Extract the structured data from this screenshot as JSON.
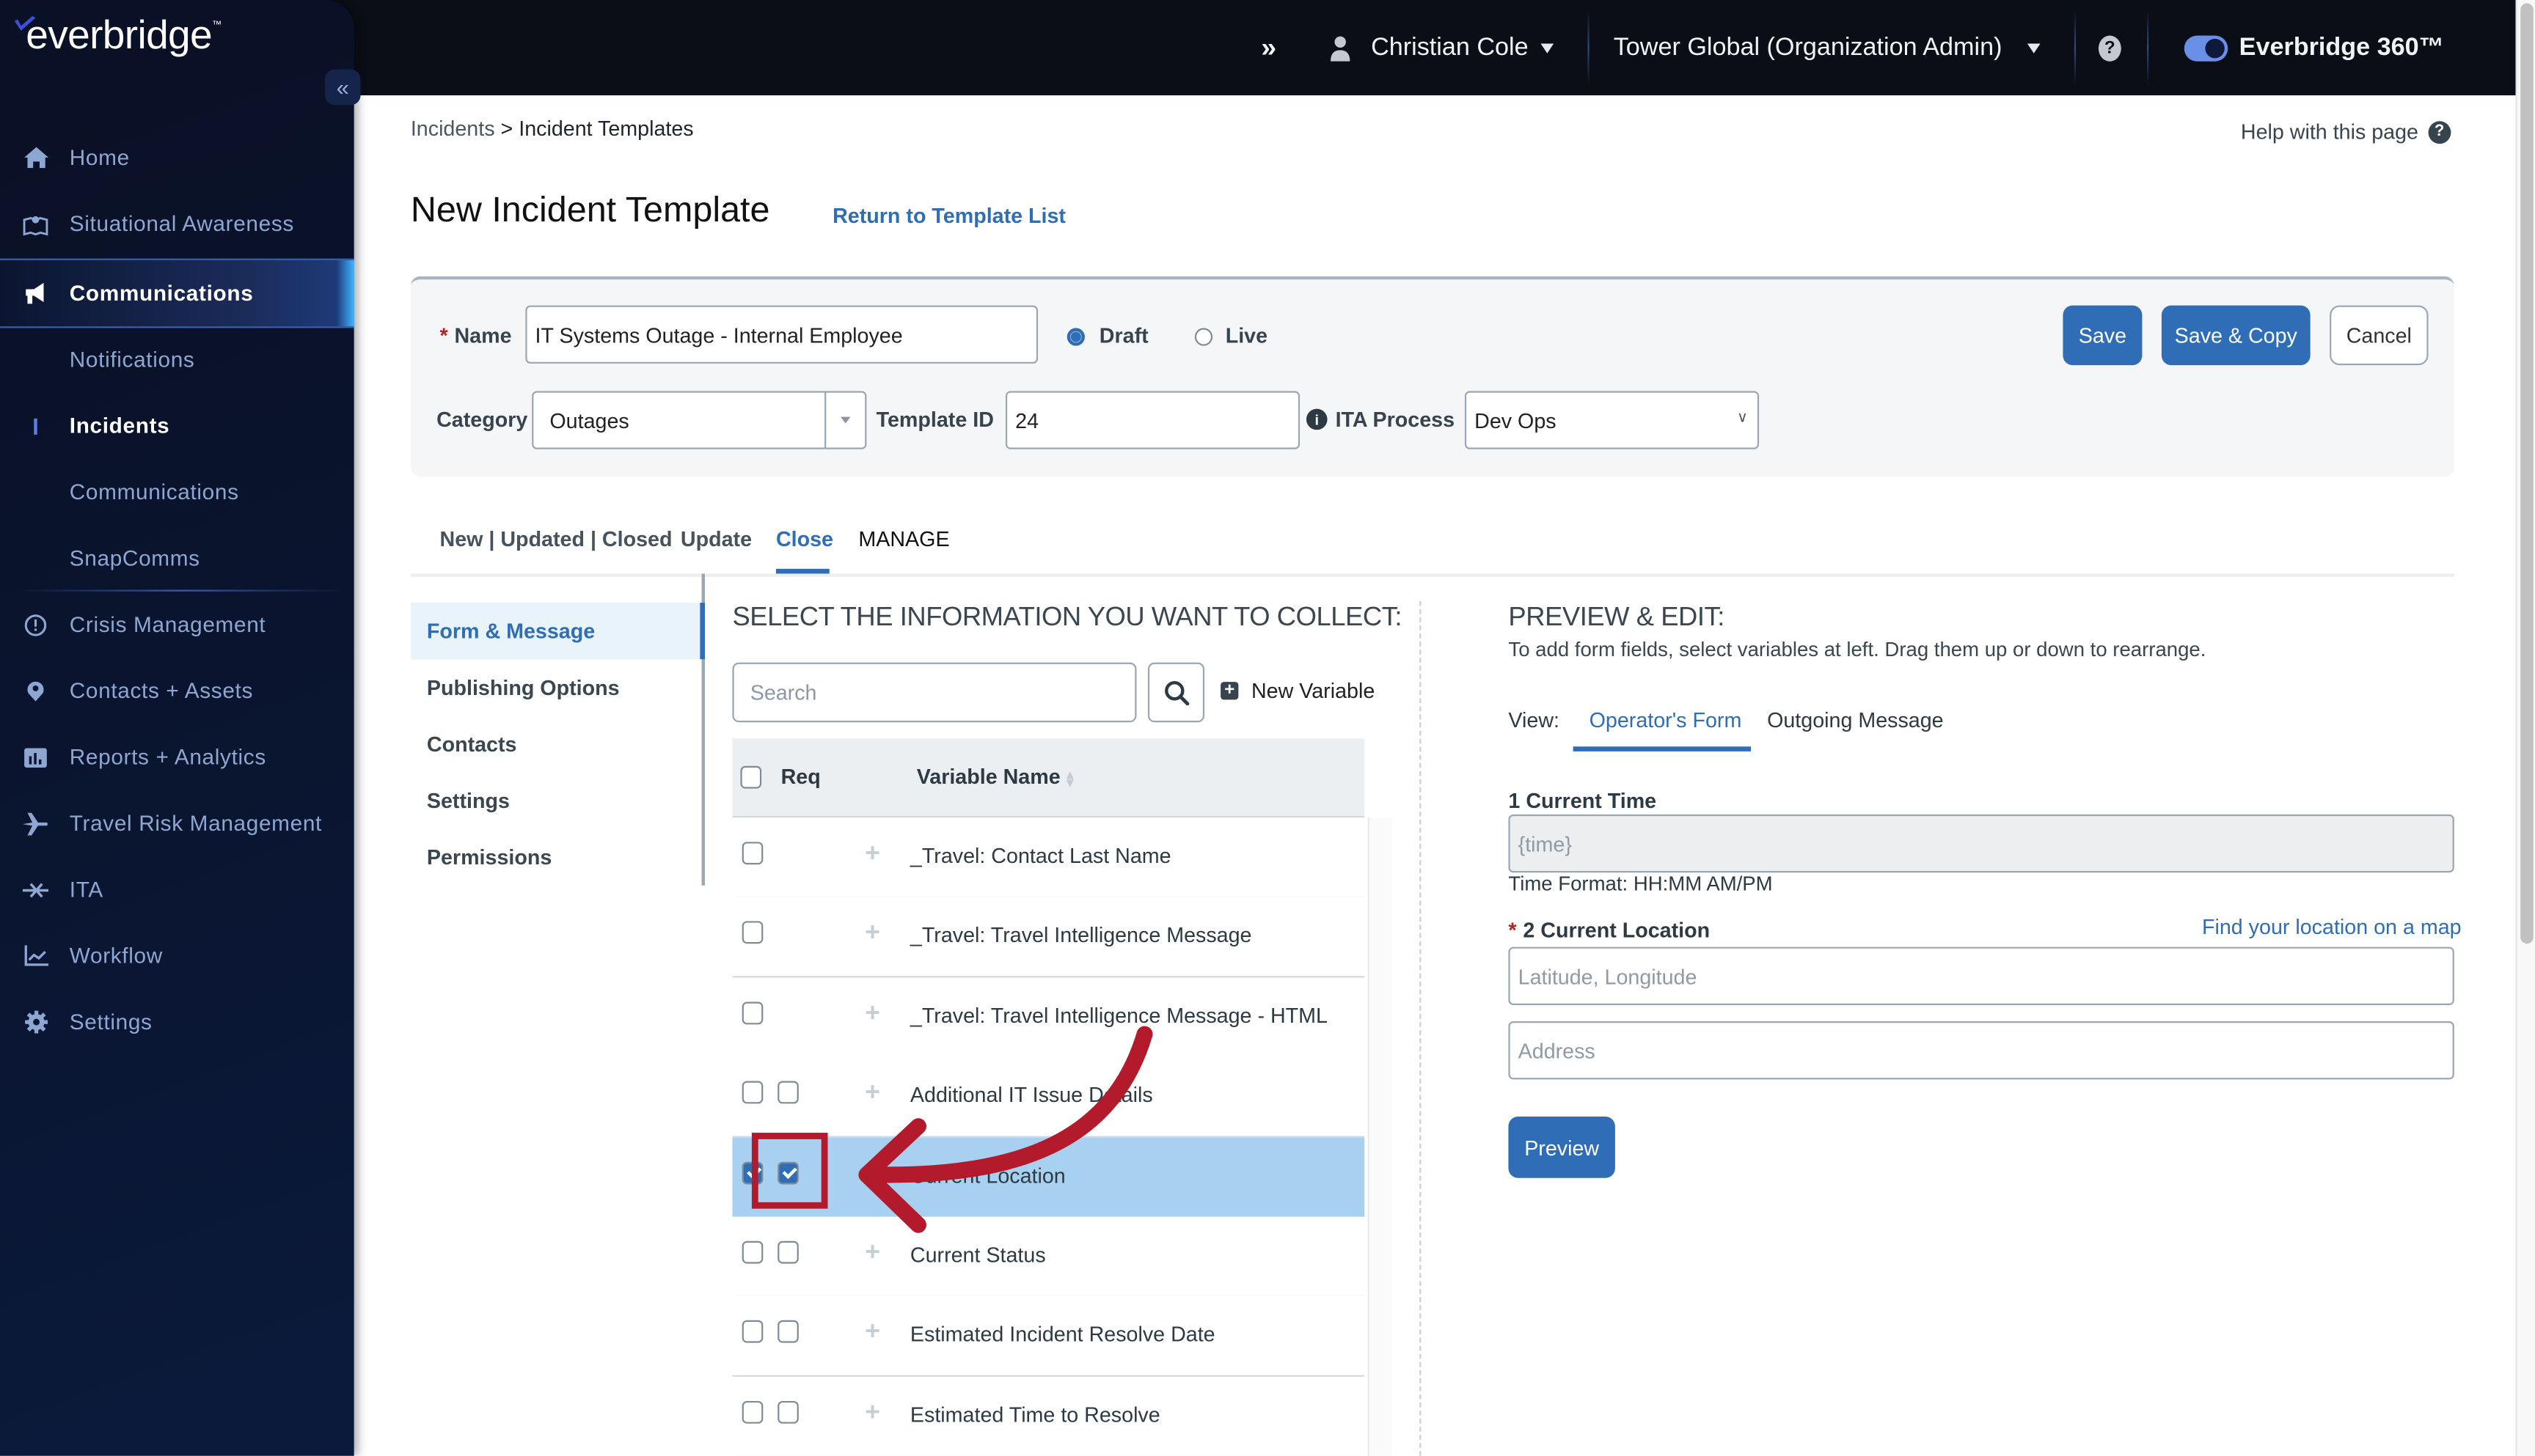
{
  "topbar": {
    "expand_icon": "double-chevron-right",
    "user_name": "Christian Cole",
    "organization": "Tower Global (Organization Admin)",
    "help_icon": "question-circle",
    "product_toggle_on": true,
    "product_name": "Everbridge 360™"
  },
  "sidebar": {
    "logo_text": "everbridge",
    "logo_tm": "™",
    "collapse_icon": "«",
    "items": [
      {
        "label": "Home",
        "icon": "home-icon"
      },
      {
        "label": "Situational Awareness",
        "icon": "map-pin-icon"
      },
      {
        "label": "Communications",
        "icon": "megaphone-icon",
        "active": true
      },
      {
        "label": "Crisis Management",
        "icon": "alert-circle-icon"
      },
      {
        "label": "Contacts + Assets",
        "icon": "contact-pin-icon"
      },
      {
        "label": "Reports + Analytics",
        "icon": "bar-chart-icon"
      },
      {
        "label": "Travel Risk Management",
        "icon": "airplane-icon"
      },
      {
        "label": "ITA",
        "icon": "ita-icon"
      },
      {
        "label": "Workflow",
        "icon": "line-chart-icon"
      },
      {
        "label": "Settings",
        "icon": "gear-icon"
      }
    ],
    "subitems": [
      {
        "label": "Notifications"
      },
      {
        "label": "Incidents",
        "active": true
      },
      {
        "label": "Communications"
      },
      {
        "label": "SnapComms"
      }
    ]
  },
  "breadcrumb": {
    "parent": "Incidents",
    "separator": " > ",
    "current": "Incident Templates"
  },
  "help_link": "Help with this page",
  "page_title": "New Incident Template",
  "return_link": "Return to Template List",
  "form": {
    "name_label": "Name",
    "name_value": "IT Systems Outage - Internal Employee",
    "status_options": [
      {
        "label": "Draft",
        "selected": true
      },
      {
        "label": "Live",
        "selected": false
      }
    ],
    "category_label": "Category",
    "category_value": "Outages",
    "template_id_label": "Template ID",
    "template_id_value": "24",
    "ita_process_label": "ITA Process",
    "ita_process_value": "Dev Ops",
    "buttons": {
      "save": "Save",
      "save_copy": "Save & Copy",
      "cancel": "Cancel"
    }
  },
  "tabs": [
    {
      "label": "New | Updated | Closed"
    },
    {
      "label": "Update"
    },
    {
      "label": "Close",
      "active": true
    },
    {
      "label": "MANAGE"
    }
  ],
  "left_nav": [
    {
      "label": "Form & Message",
      "active": true
    },
    {
      "label": "Publishing Options"
    },
    {
      "label": "Contacts"
    },
    {
      "label": "Settings"
    },
    {
      "label": "Permissions"
    }
  ],
  "collect": {
    "title": "SELECT THE INFORMATION YOU WANT TO COLLECT:",
    "search_placeholder": "Search",
    "new_variable": "New Variable",
    "columns": {
      "req": "Req",
      "variable_name": "Variable Name"
    },
    "rows": [
      {
        "name": "_Travel: Contact Last Name",
        "checked": false,
        "req": null,
        "selected": false
      },
      {
        "name": "_Travel: Travel Intelligence Message",
        "checked": false,
        "req": null,
        "selected": false
      },
      {
        "name": "_Travel: Travel Intelligence Message - HTML",
        "checked": false,
        "req": null,
        "selected": false
      },
      {
        "name": "Additional IT Issue Details",
        "checked": false,
        "req": false,
        "selected": false
      },
      {
        "name": "Current Location",
        "checked": true,
        "req": true,
        "selected": true
      },
      {
        "name": "Current Status",
        "checked": false,
        "req": false,
        "selected": false
      },
      {
        "name": "Estimated Incident Resolve Date",
        "checked": false,
        "req": false,
        "selected": false
      },
      {
        "name": "Estimated Time to Resolve",
        "checked": false,
        "req": false,
        "selected": false
      }
    ]
  },
  "preview": {
    "title": "PREVIEW & EDIT:",
    "description": "To add form fields, select variables at left. Drag them up or down to rearrange.",
    "view_label": "View:",
    "view_tabs": [
      {
        "label": "Operator's Form",
        "active": true
      },
      {
        "label": "Outgoing Message"
      }
    ],
    "fields": {
      "f1_label": "1 Current Time",
      "f1_value": "{time}",
      "f1_help": "Time Format: HH:MM AM/PM",
      "f2_label": "2 Current Location",
      "f2_required": true,
      "f2_map_link": "Find your location on a map",
      "f2_latlng_placeholder": "Latitude, Longitude",
      "f2_address_placeholder": "Address"
    },
    "preview_button": "Preview"
  },
  "annotation": {
    "color": "#b31b2c",
    "target": "req-checkbox-current-location"
  }
}
